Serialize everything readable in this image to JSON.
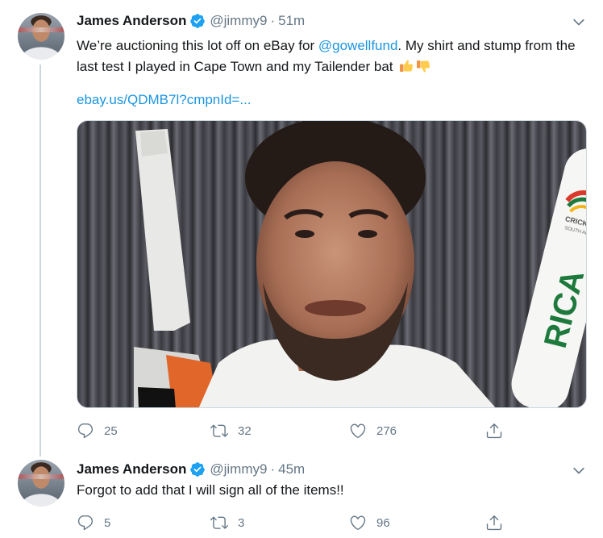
{
  "tweets": [
    {
      "author": {
        "name": "James Anderson",
        "handle": "@jimmy9"
      },
      "separator": "·",
      "time": "51m",
      "text_before": "We’re auctioning this lot off on eBay for ",
      "mention": "@gowellfund",
      "text_after": ". My shirt and stump from the last test I played in Cape Town and my Tailender bat",
      "emojis": [
        "thumbs-up",
        "thumbs-down"
      ],
      "link": "ebay.us/QDMB7l?cmpnId=...",
      "counts": {
        "replies": "25",
        "retweets": "32",
        "likes": "276"
      }
    },
    {
      "author": {
        "name": "James Anderson",
        "handle": "@jimmy9"
      },
      "separator": "·",
      "time": "45m",
      "text": "Forgot to add that I will sign all of the items!!",
      "counts": {
        "replies": "5",
        "retweets": "3",
        "likes": "96"
      }
    }
  ],
  "media_overlay_text": [
    "CRICK",
    "SOUTH AF",
    "RICA"
  ],
  "icons": [
    "verified-badge-icon",
    "caret-down-icon",
    "reply-icon",
    "retweet-icon",
    "like-icon",
    "share-icon"
  ],
  "colors": {
    "link": "#1b95e0",
    "muted": "#657786",
    "verified": "#1da1f2",
    "thread": "#ccd6dd"
  }
}
